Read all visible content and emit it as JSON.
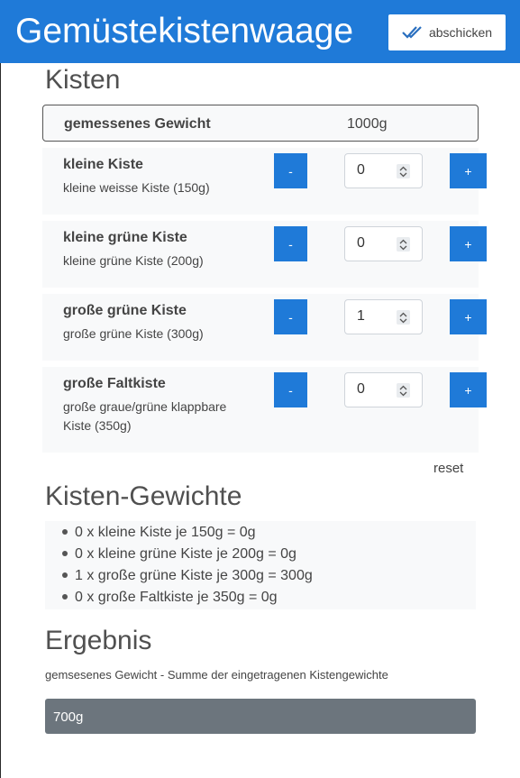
{
  "header": {
    "title": "Gemüstekistenwaage",
    "submit_label": "abschicken"
  },
  "crates_section": {
    "heading": "Kisten",
    "measured_label": "gemessenes Gewicht",
    "measured_value": "1000g",
    "items": [
      {
        "name": "kleine Kiste",
        "desc": "kleine weisse Kiste (150g)",
        "count": "0"
      },
      {
        "name": "kleine grüne Kiste",
        "desc": "kleine grüne Kiste (200g)",
        "count": "0"
      },
      {
        "name": "große grüne Kiste",
        "desc": "große grüne Kiste (300g)",
        "count": "1"
      },
      {
        "name": "große Faltkiste",
        "desc": "große graue/grüne klappbare Kiste (350g)",
        "count": "0"
      }
    ],
    "minus_label": "-",
    "plus_label": "+",
    "reset_label": "reset"
  },
  "weights_section": {
    "heading": "Kisten-Gewichte",
    "lines": [
      "0 x kleine Kiste je 150g = 0g",
      "0 x kleine grüne Kiste je 200g = 0g",
      "1 x große grüne Kiste je 300g = 300g",
      "0 x große Faltkiste je 350g = 0g"
    ]
  },
  "result_section": {
    "heading": "Ergebnis",
    "description": "gemsesenes Gewicht - Summe der eingetragenen Kistengewichte",
    "value": "700g"
  },
  "colors": {
    "primary": "#1f7ad8",
    "result_bg": "#6c757d",
    "panel_bg": "#f8f9fa"
  },
  "icons": {
    "submit": "double-check-icon",
    "spinner": "spinner-arrows-icon"
  }
}
